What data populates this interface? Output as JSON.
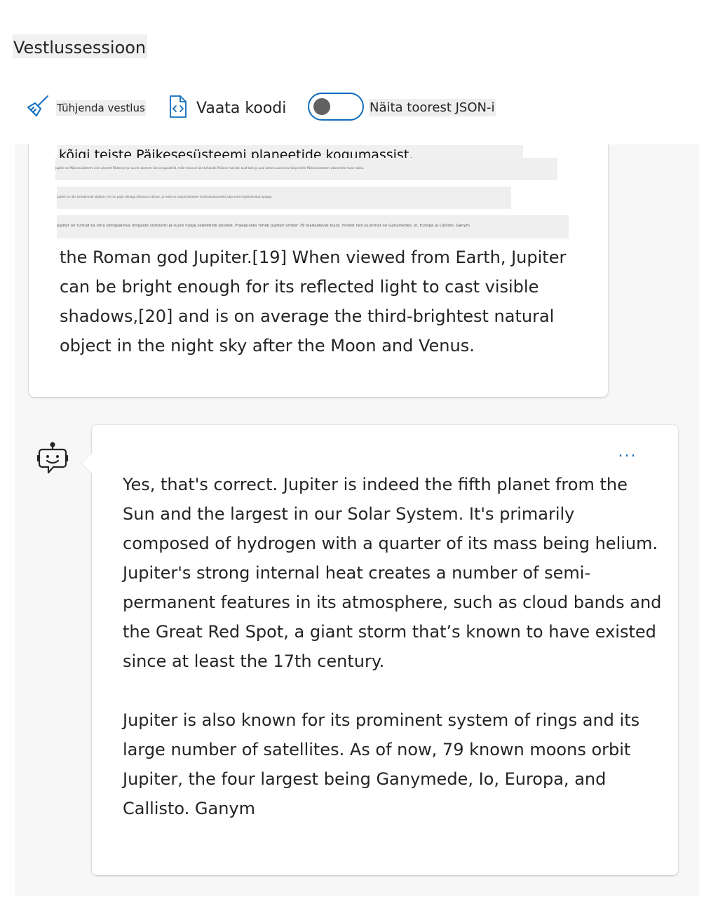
{
  "header": {
    "title": "Vestlussessioon"
  },
  "toolbar": {
    "clear_label": "Tühjenda vestlus",
    "code_label": "Vaata koodi",
    "raw_json_label": "Näita toorest JSON-i",
    "raw_json_toggle_on": false
  },
  "icons": {
    "clear": "broom-icon",
    "code": "code-file-icon",
    "assistant": "bot-icon",
    "more": "more-horizontal-icon"
  },
  "colors": {
    "accent": "#0f6cbd",
    "toggle_knob": "#616161",
    "chat_background": "#f7f7f7"
  },
  "user_message": {
    "estonian_line": "kõigi teiste Päikesesüsteemi planeetide kogumassist.",
    "small_line_1": "Jupiter on Päikesesüsteemi viies planeet Päikesest ja suurim planeet. See on gaasihiid, mille mass on üks tuhandik Päikese massist, kuid kaks ja pool korda suurem kui kõigi teiste Päikesesüsteemi planeetide mass kokku.",
    "small_line_2": "Jupiter on üks heledamaid objekte, mis on palja silmaga öötaevas nähtav, ja seda on teatud iidsetele tsivilisatsioonidele juba enne registreeritud ajalugu.",
    "small_line_3": "Jupiter on tuntud ka oma silmapaistva rõngaste süsteemi ja suure hulga satelliitide poolest. Praeguseks tiirleb Jupiteri ümber 79 teadaolevat kuud, millest neli suurimat on Ganymedes, Io, Europa ja Callisto. Ganym",
    "text": "the Roman god Jupiter.[19] When viewed from Earth, Jupiter can be bright enough for its reflected light to cast visible shadows,[20] and is on average the third-brightest natural object in the night sky after the Moon and Venus."
  },
  "assistant_message": {
    "more_label": "...",
    "paragraph_1": "Yes, that's correct. Jupiter is indeed the fifth planet from the Sun and the largest in our Solar System. It's primarily composed of hydrogen with a quarter of its mass being helium. Jupiter's strong internal heat creates a number of semi-permanent features in its atmosphere, such as cloud bands and the Great Red Spot, a giant storm that’s known to have existed since at least the 17th century.",
    "paragraph_2": "Jupiter is also known for its prominent system of rings and its large number of satellites. As of now, 79 known moons orbit Jupiter, the four largest being Ganymede, Io, Europa, and Callisto. Ganym"
  }
}
